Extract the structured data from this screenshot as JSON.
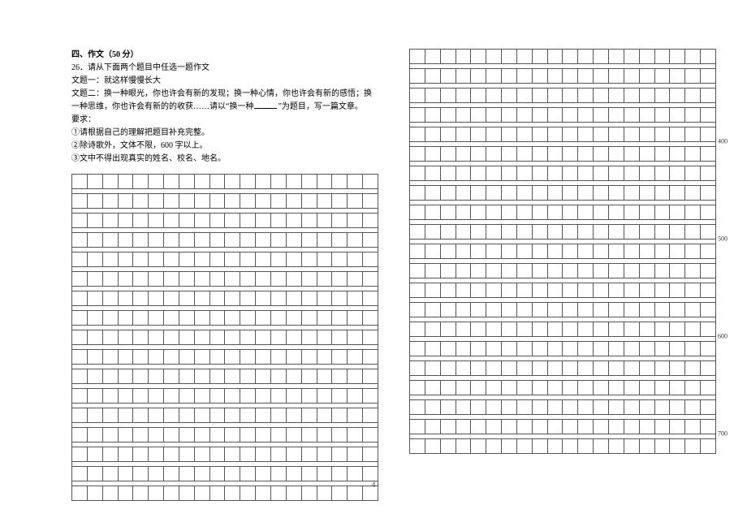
{
  "section": {
    "heading": "四、作文（50 分）",
    "q_num": "26．",
    "q_stem": "请从下面两个题目中任选一题作文",
    "topic1_label": "文题一：",
    "topic1_text": "就这样慢慢长大",
    "topic2_label": "文题二：",
    "topic2_text_a": "换一种眼光，你也许会有新的发现；换一种心情，你也许会有新的感悟；换一种思维，你也许会有新的的收获……请以“换一种",
    "topic2_text_b": "”为题目，写一篇文章。",
    "req_label": "要求：",
    "req1": "①请根据自己的理解把题目补充完整。",
    "req2": "②除诗歌外，文体不限，600 字以上。",
    "req3": "③文中不得出现真实的姓名、校名、地名。"
  },
  "grid": {
    "cols": 20,
    "left_rows": 17,
    "right_rows": 21,
    "marks": {
      "400": 5,
      "500": 10,
      "600": 15,
      "700": 20
    }
  },
  "page_number": "4"
}
